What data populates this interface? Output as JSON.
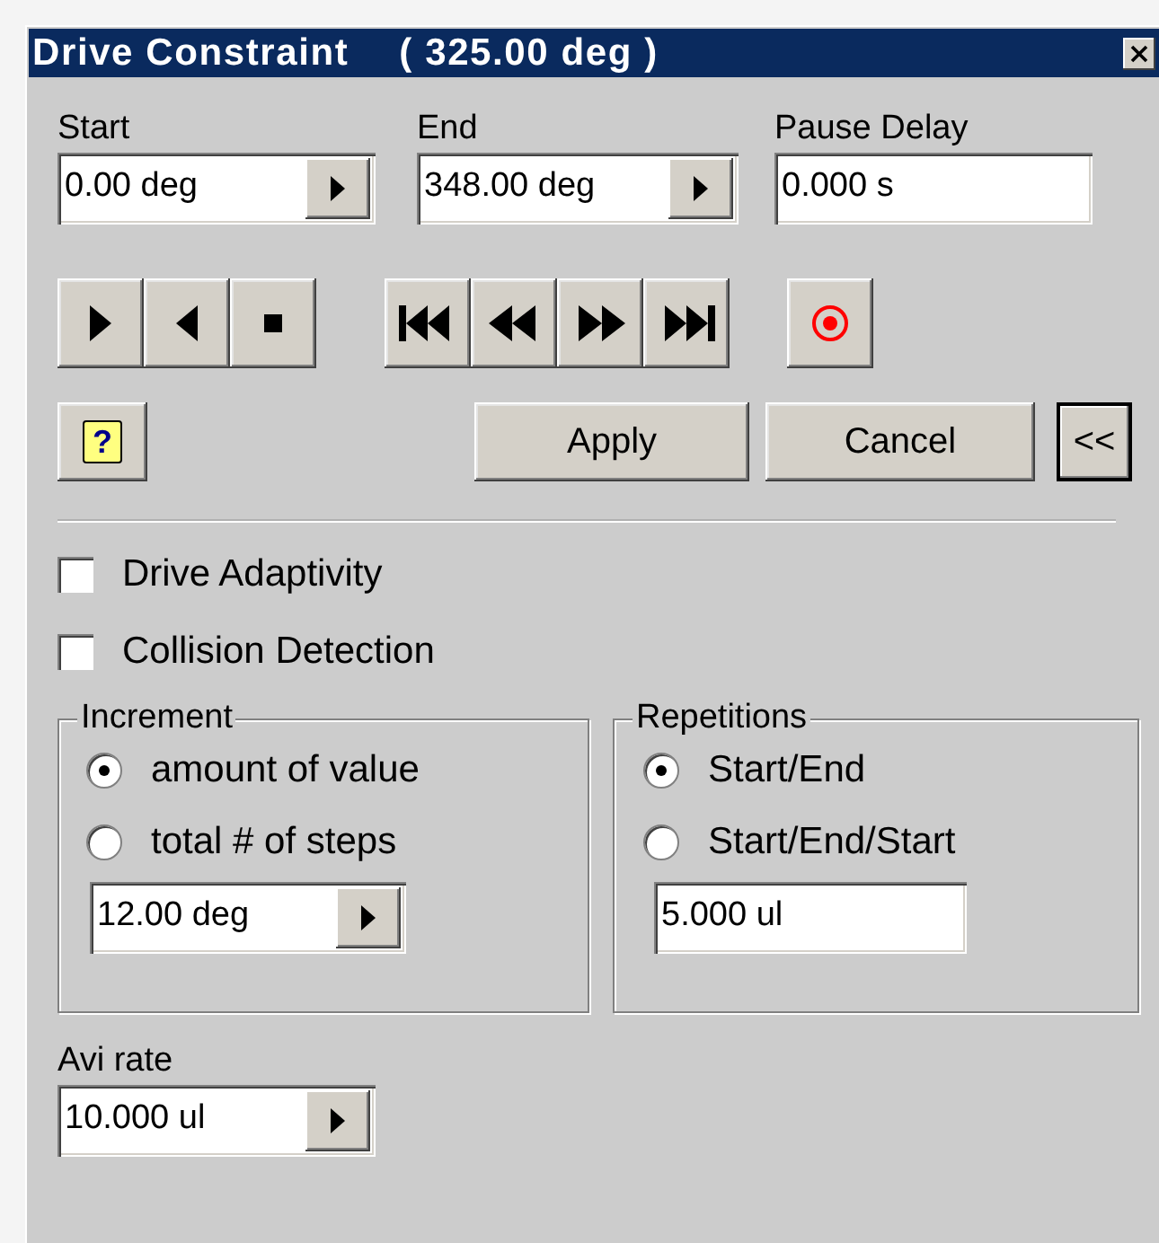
{
  "window": {
    "title": "Drive Constraint",
    "value": "( 325.00 deg )"
  },
  "fields": [
    {
      "label": "Start",
      "value": "0.00 deg",
      "kind": "spin"
    },
    {
      "label": "End",
      "value": "348.00 deg",
      "kind": "spin"
    },
    {
      "label": "Pause Delay",
      "value": "0.000 s",
      "kind": "plain"
    }
  ],
  "transport": [
    [
      {
        "kind": "play"
      },
      {
        "kind": "reverse"
      },
      {
        "kind": "stop"
      }
    ],
    [
      {
        "kind": "skip-start"
      },
      {
        "kind": "rewind"
      },
      {
        "kind": "fast-forward"
      },
      {
        "kind": "skip-end"
      }
    ],
    [
      {
        "kind": "record"
      }
    ]
  ],
  "help": {
    "glyph": "?"
  },
  "buttons": [
    {
      "label": "Apply",
      "default": false
    },
    {
      "label": "Cancel",
      "default": false
    },
    {
      "label": "<<",
      "default": true
    }
  ],
  "checkboxes": [
    {
      "label": "Drive Adaptivity",
      "checked": false
    },
    {
      "label": "Collision Detection",
      "checked": false
    }
  ],
  "groups": [
    {
      "title": "Increment",
      "options": [
        {
          "label": "amount of value",
          "selected": true
        },
        {
          "label": "total # of steps",
          "selected": false
        }
      ],
      "field": {
        "value": "12.00 deg",
        "kind": "spin"
      }
    },
    {
      "title": "Repetitions",
      "options": [
        {
          "label": "Start/End",
          "selected": true
        },
        {
          "label": "Start/End/Start",
          "selected": false
        }
      ],
      "field": {
        "value": "5.000 ul",
        "kind": "plain"
      }
    }
  ],
  "avi_rate": {
    "label": "Avi rate",
    "value": "10.000 ul",
    "kind": "spin"
  }
}
